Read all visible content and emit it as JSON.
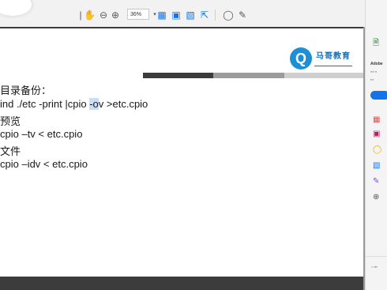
{
  "toolbar": {
    "zoom_value": "36%",
    "icons": [
      "page-nav-icon",
      "zoom-out-icon",
      "zoom-in-icon",
      "fit-page-icon",
      "export-pdf-icon",
      "organize-pages-icon",
      "comment-icon",
      "sign-icon"
    ]
  },
  "slide": {
    "logo_text": "马哥教育",
    "logo_mark": "Q",
    "lines": {
      "l1": "目录备份：",
      "l2a": "ind ./etc -print |cpio ",
      "l2b": "-o",
      "l2c": "v >etc.cpio",
      "l3": "预览",
      "l4": "cpio –tv < etc.cpio",
      "l5": "文件",
      "l6": "cpio –idv < etc.cpio"
    }
  },
  "right_pane": {
    "title": "Adobe",
    "icons": [
      "export-pdf-icon",
      "create-pdf-icon",
      "comment-icon",
      "organize-pages-icon",
      "fill-sign-icon",
      "more-tools-icon"
    ]
  },
  "colors": {
    "accent_blue": "#1473e6",
    "logo_blue": "#1d8fd6",
    "bar_dark": "#3b3b3b",
    "bar_gray": "#9c9c9c",
    "bar_light": "#cfcfcf"
  }
}
